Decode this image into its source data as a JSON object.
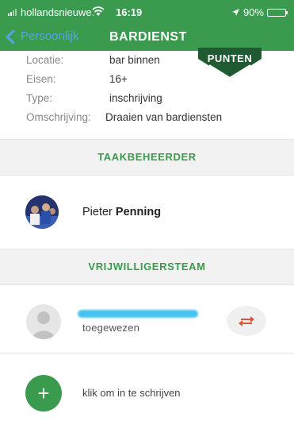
{
  "status_bar": {
    "carrier": "hollandsnieuwe.",
    "time": "16:19",
    "battery": "90%",
    "battery_level": 0.9
  },
  "nav": {
    "back_label": "Persoonlijk",
    "title": "BARDIENST"
  },
  "badge": {
    "label": "PUNTEN"
  },
  "details": [
    {
      "label": "Locatie:",
      "value": "bar binnen"
    },
    {
      "label": "Eisen:",
      "value": "16+"
    },
    {
      "label": "Type:",
      "value": "inschrijving"
    },
    {
      "label": "Omschrijving:",
      "value": "Draaien van bardiensten"
    }
  ],
  "manager": {
    "header": "TAAKBEHEERDER",
    "first_name": "Pieter",
    "last_name": "Penning"
  },
  "team": {
    "header": "VRIJWILLIGERSTEAM",
    "assigned_label": "toegewezen",
    "signup_label": "klik om in te schrijven",
    "add_symbol": "+"
  },
  "colors": {
    "accent": "#3a9a4e",
    "back_link": "#5aa3e8",
    "swap_icon": "#d9553e"
  },
  "icons": {
    "back": "chevron-left-icon",
    "swap": "swap-arrows-icon",
    "add": "plus-icon",
    "placeholder": "person-placeholder-icon"
  }
}
